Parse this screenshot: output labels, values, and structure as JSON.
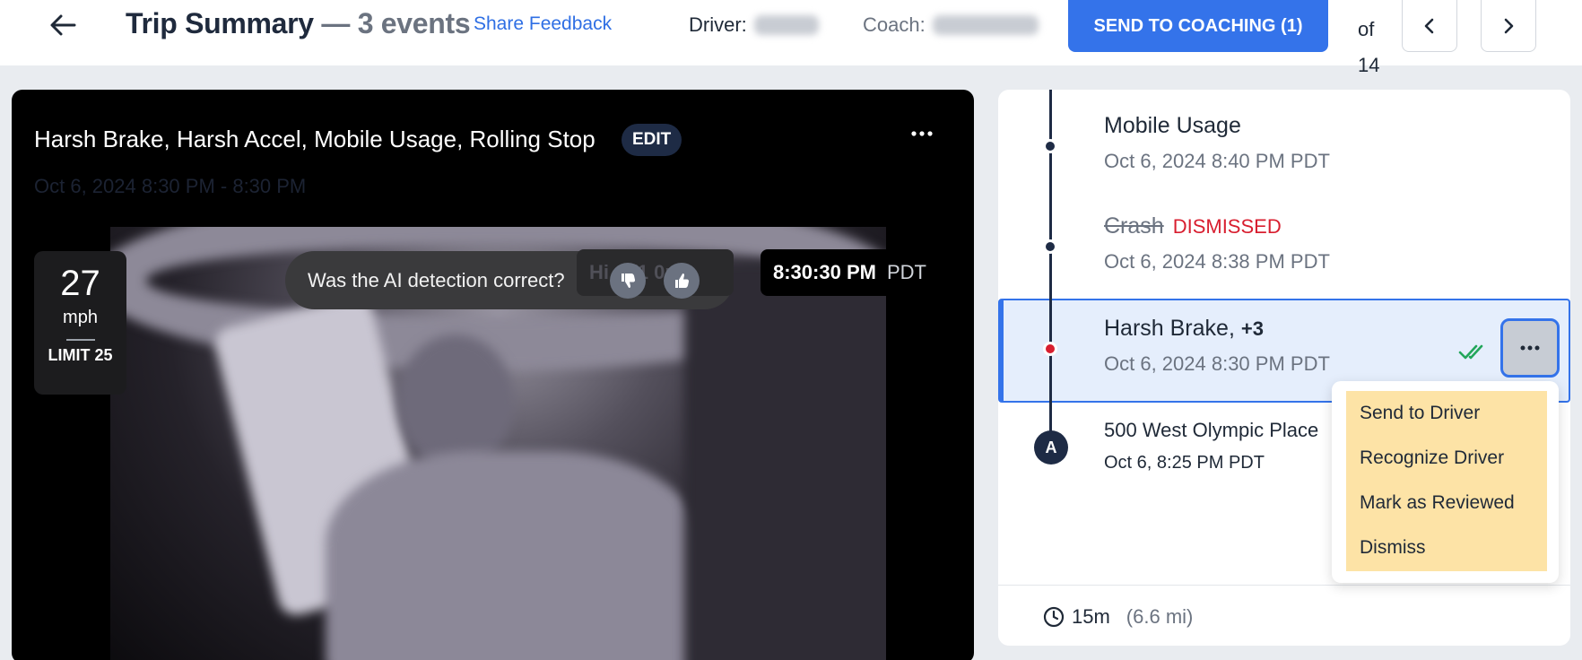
{
  "header": {
    "title": "Trip Summary",
    "title_suffix": " — 3 events",
    "share_feedback": "Share Feedback",
    "driver_label": "Driver:",
    "coach_label": "Coach:",
    "send_button": "SEND TO COACHING (1)",
    "pager_of": "of 14"
  },
  "video": {
    "event_title": "Harsh Brake, Harsh Accel, Mobile Usage, Rolling Stop",
    "edit_label": "EDIT",
    "event_time": "Oct 6, 2024 8:30 PM - 8:30 PM",
    "speed": "27",
    "speed_unit": "mph",
    "speed_limit": "LIMIT 25",
    "ai_question": "Was the AI detection correct?",
    "ghost_label": "Hi s (1 0p)",
    "timestamp": "8:30:30 PM",
    "timezone": "PDT"
  },
  "timeline": {
    "events": [
      {
        "name": "Mobile Usage",
        "date": "Oct 6, 2024 8:40 PM PDT"
      },
      {
        "name": "Crash",
        "status": "DISMISSED",
        "date": "Oct 6, 2024 8:38 PM PDT"
      },
      {
        "name": "Harsh Brake,",
        "extra": "+3",
        "date": "Oct 6, 2024 8:30 PM PDT"
      }
    ],
    "start": {
      "marker": "A",
      "address": "500 West Olympic Place",
      "date": "Oct 6, 8:25 PM PDT"
    },
    "duration": "15m",
    "distance": "(6.6 mi)"
  },
  "menu": {
    "items": [
      "Send to Driver",
      "Recognize Driver",
      "Mark as Reviewed",
      "Dismiss"
    ]
  },
  "colors": {
    "accent": "#3473ea",
    "navy": "#1e2b45",
    "danger": "#d81e2f",
    "success": "#22a65a",
    "menu_highlight": "#fde3a6"
  },
  "icons": [
    "back-arrow-icon",
    "chevron-left-icon",
    "chevron-right-icon",
    "more-horizontal-icon",
    "thumbs-down-icon",
    "thumbs-up-icon",
    "double-check-icon",
    "clock-icon"
  ]
}
